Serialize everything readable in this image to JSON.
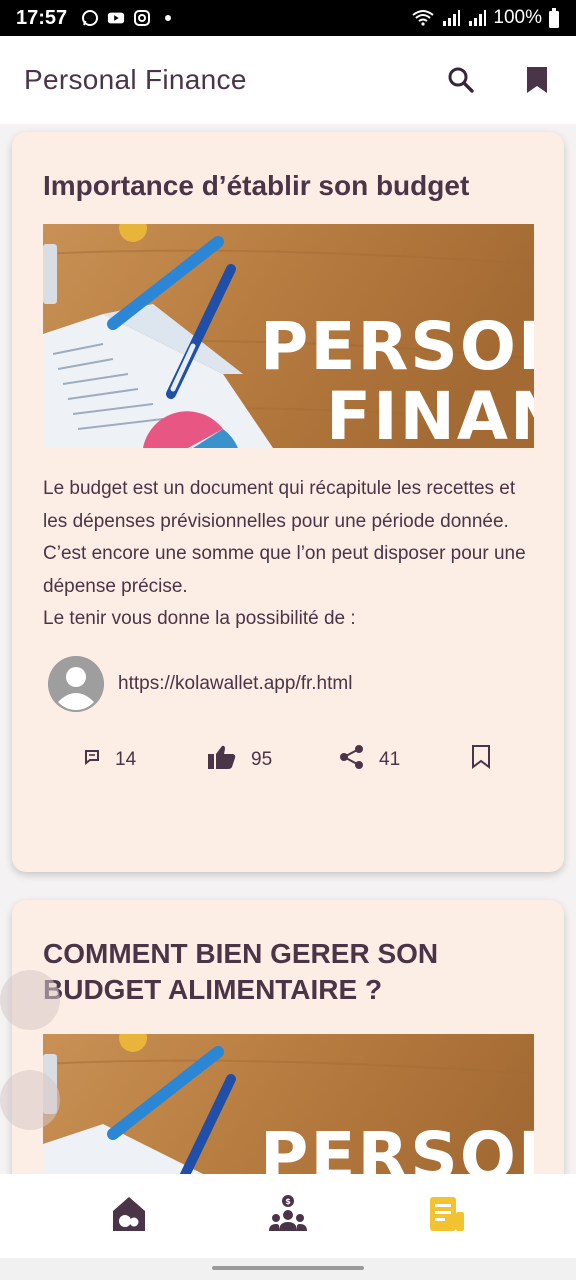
{
  "status_bar": {
    "time": "17:57",
    "battery": "100%",
    "left_icons": [
      "whatsapp-icon",
      "youtube-icon",
      "instagram-icon",
      "dot-icon"
    ],
    "right_icons": [
      "wifi-icon",
      "signal-icon",
      "signal-icon",
      "battery-icon"
    ]
  },
  "app_bar": {
    "title": "Personal Finance",
    "actions": [
      "search-icon",
      "bookmark-icon"
    ]
  },
  "feed": {
    "cards": [
      {
        "title": "Importance d’établir son budget",
        "image_text": [
          "PERSON",
          "FINAN"
        ],
        "body": [
          "Le budget est un document qui récapitule les recettes et les dépenses prévisionnelles pour une période donnée.",
          "C’est encore une somme que l’on peut disposer pour une dépense précise.",
          "Le tenir vous donne la possibilité de :"
        ],
        "source_url": "https://kolawallet.app/fr.html",
        "comments": "14",
        "likes": "95",
        "shares": "41"
      },
      {
        "title": "COMMENT BIEN GERER SON BUDGET ALIMENTAIRE ?",
        "image_text": [
          "PERSON"
        ]
      }
    ]
  },
  "floating_buttons": [
    "eye-icon",
    "menu-icon"
  ],
  "bottom_nav": {
    "items": [
      "home-icon",
      "community-icon",
      "articles-icon"
    ],
    "active": "articles-icon"
  },
  "colors": {
    "primary": "#4a3447",
    "card_background": "#fdeee5",
    "active_nav": "#f2c230",
    "status_bar": "#000000"
  }
}
